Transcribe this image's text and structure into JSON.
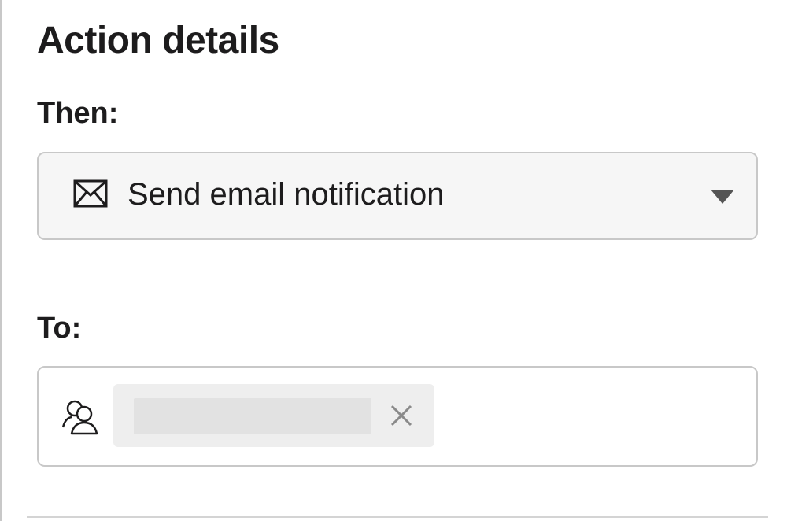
{
  "panel": {
    "title": "Action details"
  },
  "then": {
    "label": "Then:",
    "selected_action": "Send email notification",
    "action_icon": "mail-icon",
    "dropdown_icon": "caret-down-icon"
  },
  "to": {
    "label": "To:",
    "field_icon": "people-icon",
    "recipients": [
      {
        "name": "",
        "remove_icon": "close-icon"
      }
    ]
  }
}
